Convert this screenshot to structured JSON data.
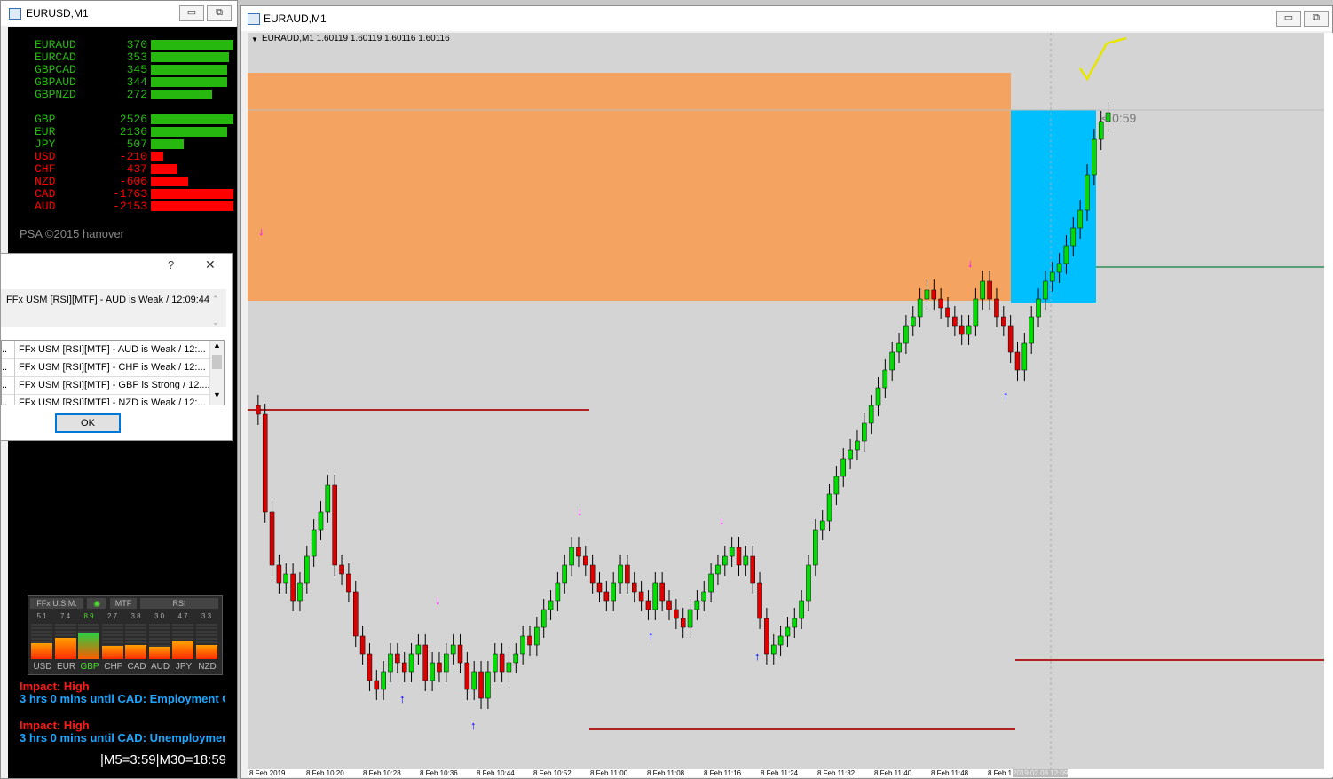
{
  "left_window": {
    "title": "EURUSD,M1",
    "min_label": "▭",
    "max_label": "⧉"
  },
  "strength_panel": {
    "pairs": [
      {
        "name": "EURAUD",
        "value": "370",
        "level": 1.0
      },
      {
        "name": "EURCAD",
        "value": "353",
        "level": 0.95
      },
      {
        "name": "GBPCAD",
        "value": "345",
        "level": 0.93
      },
      {
        "name": "GBPAUD",
        "value": "344",
        "level": 0.93
      },
      {
        "name": "GBPNZD",
        "value": "272",
        "level": 0.74
      }
    ],
    "currencies": [
      {
        "name": "GBP",
        "value": "2526",
        "level": 1.0,
        "color": "#27b80f"
      },
      {
        "name": "EUR",
        "value": "2136",
        "level": 0.92,
        "color": "#27b80f"
      },
      {
        "name": "JPY",
        "value": "507",
        "level": 0.4,
        "color": "#27b80f"
      },
      {
        "name": "USD",
        "value": "-210",
        "level": 0.15,
        "color": "#ff0000"
      },
      {
        "name": "CHF",
        "value": "-437",
        "level": 0.32,
        "color": "#ff0000"
      },
      {
        "name": "NZD",
        "value": "-606",
        "level": 0.45,
        "color": "#ff0000"
      },
      {
        "name": "CAD",
        "value": "-1763",
        "level": 1.0,
        "color": "#ff0000"
      },
      {
        "name": "AUD",
        "value": "-2153",
        "level": 1.0,
        "color": "#ff0000"
      }
    ],
    "copyright": "PSA ©2015 hanover"
  },
  "usm_widget": {
    "tabs": [
      "FFx U.S.M.",
      "MTF",
      "RSI"
    ],
    "values": [
      "5.1",
      "7.4",
      "8.9",
      "2.7",
      "3.8",
      "3.0",
      "4.7",
      "3.3"
    ],
    "currencies": [
      "USD",
      "EUR",
      "GBP",
      "CHF",
      "CAD",
      "AUD",
      "JPY",
      "NZD"
    ],
    "levels": [
      0.45,
      0.6,
      0.72,
      0.38,
      0.4,
      0.35,
      0.5,
      0.4
    ],
    "highlight": "GBP"
  },
  "news": [
    {
      "impact": "Impact: High",
      "text": "3 hrs 0 mins until CAD: Employment C"
    },
    {
      "impact": "Impact: High",
      "text": "3 hrs 0 mins until CAD: Unemploymen"
    }
  ],
  "timer": "|M5=3:59|M30=18:59",
  "alert_dialog": {
    "help_label": "?",
    "close_label": "✕",
    "message": "FFx USM [RSI][MTF] - AUD is Weak / 12:09:44",
    "list": [
      "FFx USM [RSI][MTF] - AUD is Weak / 12:...",
      "FFx USM [RSI][MTF] - CHF is Weak / 12:...",
      "FFx USM [RSI][MTF] - GBP is Strong / 12....",
      "FFx USM [RSI][MTF] - NZD is Weak / 12:..."
    ],
    "ok_label": "OK"
  },
  "chart_window": {
    "title": "EURAUD,M1",
    "ohlc_label": "EURAUD,M1  1.60119 1.60119 1.60116 1.60116",
    "countdown": "< 0:59",
    "time_labels": [
      "8 Feb 2019",
      "8 Feb 10:20",
      "8 Feb 10:28",
      "8 Feb 10:36",
      "8 Feb 10:44",
      "8 Feb 10:52",
      "8 Feb 11:00",
      "8 Feb 11:08",
      "8 Feb 11:16",
      "8 Feb 11:24",
      "8 Feb 11:32",
      "8 Feb 11:40",
      "8 Feb 11:48",
      "8 Feb 1",
      "2019.02.08 12:09"
    ],
    "colors": {
      "zone_supply": "#f4a460",
      "zone_active": "#00bfff",
      "bull": "#00dd00",
      "bear": "#dd0000",
      "level_line": "#b22222",
      "signal_up": "#0000ff",
      "signal_down": "#ff00ff"
    }
  }
}
